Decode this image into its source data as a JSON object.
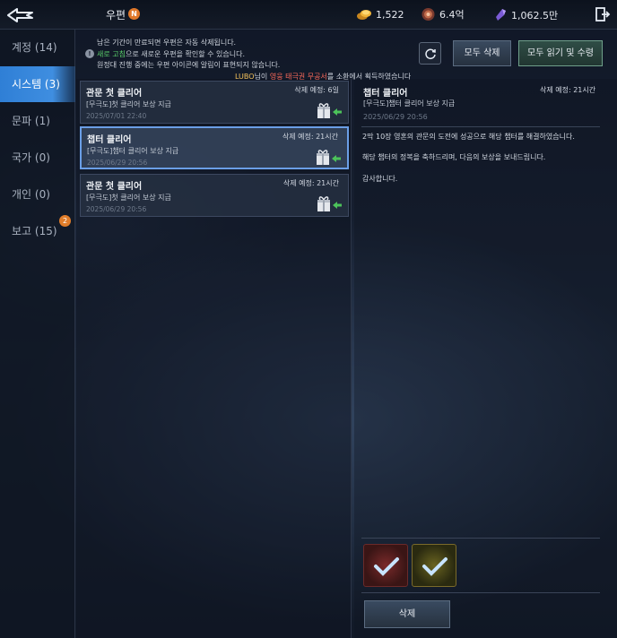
{
  "header": {
    "title": "우편",
    "title_badge": "N",
    "currencies": [
      {
        "icon": "gold-coin-icon",
        "value": "1,522"
      },
      {
        "icon": "jewel-icon",
        "value": "6.4억"
      },
      {
        "icon": "crystal-icon",
        "value": "1,062.5만"
      }
    ]
  },
  "sidebar": {
    "items": [
      {
        "label": "계정 (14)"
      },
      {
        "label": "시스템 (3)"
      },
      {
        "label": "문파 (1)"
      },
      {
        "label": "국가 (0)"
      },
      {
        "label": "개인 (0)"
      },
      {
        "label": "보고 (15)"
      }
    ],
    "report_badge": "2"
  },
  "notice": {
    "line1": "남은 기간이 만료되면 우편은 자동 삭제됩니다.",
    "line2_green": "새로 고침",
    "line2_rest": "으로 새로운 우편을 확인할 수 있습니다.",
    "line3": "원정대 진행 중에는 우편 아이콘에 알림이 표현되지 않습니다."
  },
  "toolbar": {
    "delete_all": "모두 삭제",
    "read_all": "모두 읽기 및 수령"
  },
  "banner": {
    "user": "LUBO",
    "mid": "님이 ",
    "item": "영웅 태극권 무공서",
    "rest": "를 소환에서 획득하였습니다"
  },
  "mails": [
    {
      "title": "관문 첫 클리어",
      "deadline": "삭제 예정: 6일",
      "subtitle": "[무극도]첫 클리어 보상 지급",
      "date": "2025/07/01 22:40"
    },
    {
      "title": "챕터 클리어",
      "deadline": "삭제 예정: 21시간",
      "subtitle": "[무극도]챕터 클리어 보상 지급",
      "date": "2025/06/29 20:56"
    },
    {
      "title": "관문 첫 클리어",
      "deadline": "삭제 예정: 21시간",
      "subtitle": "[무극도]첫 클리어 보상 지급",
      "date": "2025/06/29 20:56"
    }
  ],
  "detail": {
    "title": "챕터 클리어",
    "deadline": "삭제 예정: 21시간",
    "subtitle": "[무극도]챕터 클리어 보상 지급",
    "date": "2025/06/29 20:56",
    "body": [
      "2막 10장 영혼의 관문의 도전에 성공으로 해당 챕터를 해결하였습니다.",
      "해당 챕터의 정복을 축하드리며, 다음의 보상을 보내드립니다.",
      "감사합니다."
    ],
    "delete_label": "삭제"
  },
  "colors": {
    "accent": "#3f8ee0",
    "green_text": "#5bd06b",
    "highlight": "#ff6b5b"
  }
}
